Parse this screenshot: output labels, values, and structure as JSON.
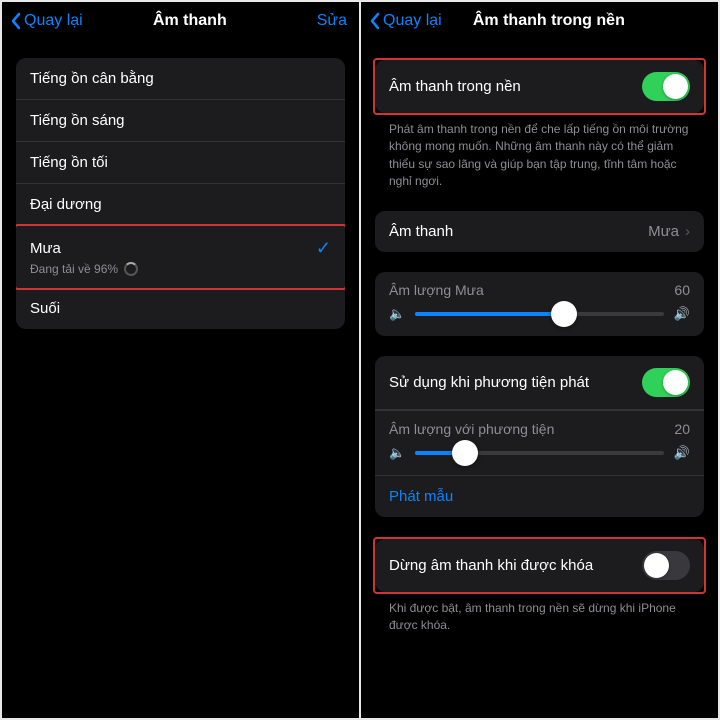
{
  "left": {
    "back": "Quay lại",
    "title": "Âm thanh",
    "edit": "Sửa",
    "items": [
      {
        "label": "Tiếng ồn cân bằng"
      },
      {
        "label": "Tiếng ồn sáng"
      },
      {
        "label": "Tiếng ồn tối"
      },
      {
        "label": "Đại dương"
      },
      {
        "label": "Mưa",
        "sub": "Đang tải về 96%",
        "selected": true,
        "highlight": true
      },
      {
        "label": "Suối"
      }
    ]
  },
  "right": {
    "back": "Quay lại",
    "title": "Âm thanh trong nền",
    "toggle1": {
      "label": "Âm thanh trong nền",
      "on": true
    },
    "desc1": "Phát âm thanh trong nền để che lấp tiếng ồn môi trường không mong muốn. Những âm thanh này có thể giảm thiểu sự sao lãng và giúp bạn tập trung, tĩnh tâm hoặc nghỉ ngơi.",
    "sound": {
      "label": "Âm thanh",
      "value": "Mưa"
    },
    "slider1": {
      "label": "Âm lượng Mưa",
      "value": 60
    },
    "toggle2": {
      "label": "Sử dụng khi phương tiện phát",
      "on": true
    },
    "slider2": {
      "label": "Âm lượng với phương tiện",
      "value": 20
    },
    "sample": "Phát mẫu",
    "toggle3": {
      "label": "Dừng âm thanh khi được khóa",
      "on": false
    },
    "desc3": "Khi được bật, âm thanh trong nền sẽ dừng khi iPhone được khóa."
  }
}
